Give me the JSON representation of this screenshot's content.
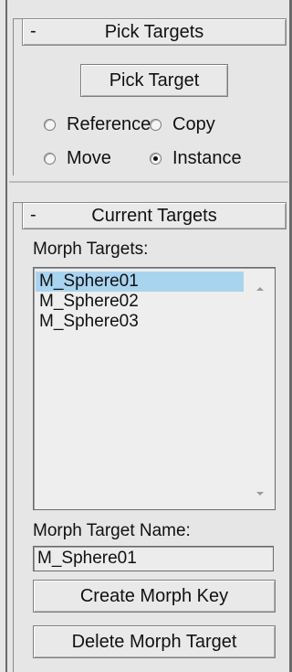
{
  "pick_targets": {
    "toggle": "-",
    "title": "Pick Targets",
    "pick_button": "Pick Target",
    "options": [
      {
        "label": "Reference",
        "checked": false
      },
      {
        "label": "Copy",
        "checked": false
      },
      {
        "label": "Move",
        "checked": false
      },
      {
        "label": "Instance",
        "checked": true
      }
    ]
  },
  "current_targets": {
    "toggle": "-",
    "title": "Current Targets",
    "list_label": "Morph Targets:",
    "items": [
      "M_Sphere01",
      "M_Sphere02",
      "M_Sphere03"
    ],
    "selected_index": 0,
    "name_label": "Morph Target Name:",
    "name_value": "M_Sphere01",
    "create_button": "Create Morph Key",
    "delete_button": "Delete Morph Target"
  }
}
